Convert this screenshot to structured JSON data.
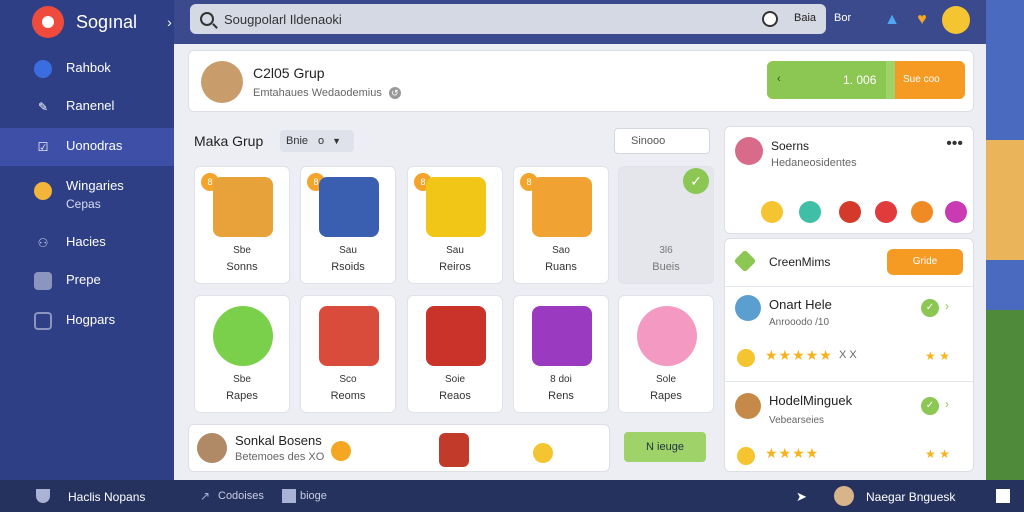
{
  "colors": {
    "sidebar": "#2e3f86",
    "accent_green": "#8cc653",
    "accent_orange": "#f59a23",
    "coin": "#f5c431"
  },
  "app": {
    "brand": "Sogınal",
    "brand_chevron": "›"
  },
  "sidebar": {
    "items": [
      {
        "label": "Rahbok",
        "icon": "search-icon"
      },
      {
        "label": "Ranenel",
        "icon": "pen-icon"
      },
      {
        "label": "Uonodras",
        "icon": "checkbox-icon"
      },
      {
        "label": "Wingaries",
        "sub": "Cepas",
        "icon": "coin-icon"
      },
      {
        "label": "Hacies",
        "icon": "user-icon"
      },
      {
        "label": "Prepe",
        "icon": "box-icon"
      },
      {
        "label": "Hogpars",
        "icon": "image-icon"
      }
    ]
  },
  "topbar": {
    "search_text": "Sougpolarl Ildenaoki",
    "search_button": "Baia",
    "right_label": "Bor",
    "icons": [
      "alert-triangle-icon",
      "heart-icon",
      "profile-avatar-icon"
    ]
  },
  "group": {
    "title": "C2l05 Grup",
    "subtitle": "Emtahaues Wedaodemius",
    "progress_left": "‹",
    "progress_value": "1. 006",
    "progress_fraction": 0.6,
    "progress_action": "Sue  coo"
  },
  "section": {
    "title": "Maka Grup",
    "filter": "Bnie",
    "filter_count": "o",
    "sort_placeholder": "Sinooo"
  },
  "tiles": [
    {
      "badge": "8",
      "line1": "Sbe",
      "line2": "Sonns",
      "art": "#e8a23a"
    },
    {
      "badge": "8",
      "line1": "Sau",
      "line2": "Rsoids",
      "art": "#3a5fb0"
    },
    {
      "badge": "8",
      "line1": "Sau",
      "line2": "Reiros",
      "art": "#f1c617"
    },
    {
      "badge": "8",
      "line1": "Sao",
      "line2": "Ruans",
      "art": "#f0a232"
    },
    {
      "badge": "",
      "line1": "3l6",
      "line2": "Bueis",
      "art": "",
      "placeholder": true
    },
    {
      "badge": "",
      "line1": "Sbe",
      "line2": "Rapes",
      "art": "#7ad04a"
    },
    {
      "badge": "",
      "line1": "Sco",
      "line2": "Reoms",
      "art": "#d94b3a"
    },
    {
      "badge": "",
      "line1": "Soie",
      "line2": "Reaos",
      "art": "#c9332a"
    },
    {
      "badge": "",
      "line1": "8 doi",
      "line2": "Rens",
      "art": "#9a3ac0"
    },
    {
      "badge": "",
      "line1": "Sole",
      "line2": "Rapes",
      "art": "#f49ac2"
    }
  ],
  "social": {
    "title": "Sonkal Bosens",
    "subtitle": "Betemoes des XO",
    "button": "N ieuge"
  },
  "panel1": {
    "title": "Soerns",
    "subtitle": "Hedaneosidentes",
    "menu": "•••"
  },
  "panel2": {
    "title": "CreenMims",
    "button": "Gride",
    "rows": [
      {
        "name": "Onart Hele",
        "sub": "Anrooodo /10",
        "stars": "★★★★★",
        "suffix": "X X",
        "extra": "★ ★"
      },
      {
        "name": "HodelMinguek",
        "sub": "Vebearseies",
        "stars": "★★★★",
        "suffix": "",
        "extra": "★ ★"
      }
    ]
  },
  "bottombar": {
    "left_label": "Haclis Nopans",
    "middle_1": "Codoises",
    "middle_2": "bioge",
    "right_label": "Naegar Bnguesk"
  }
}
